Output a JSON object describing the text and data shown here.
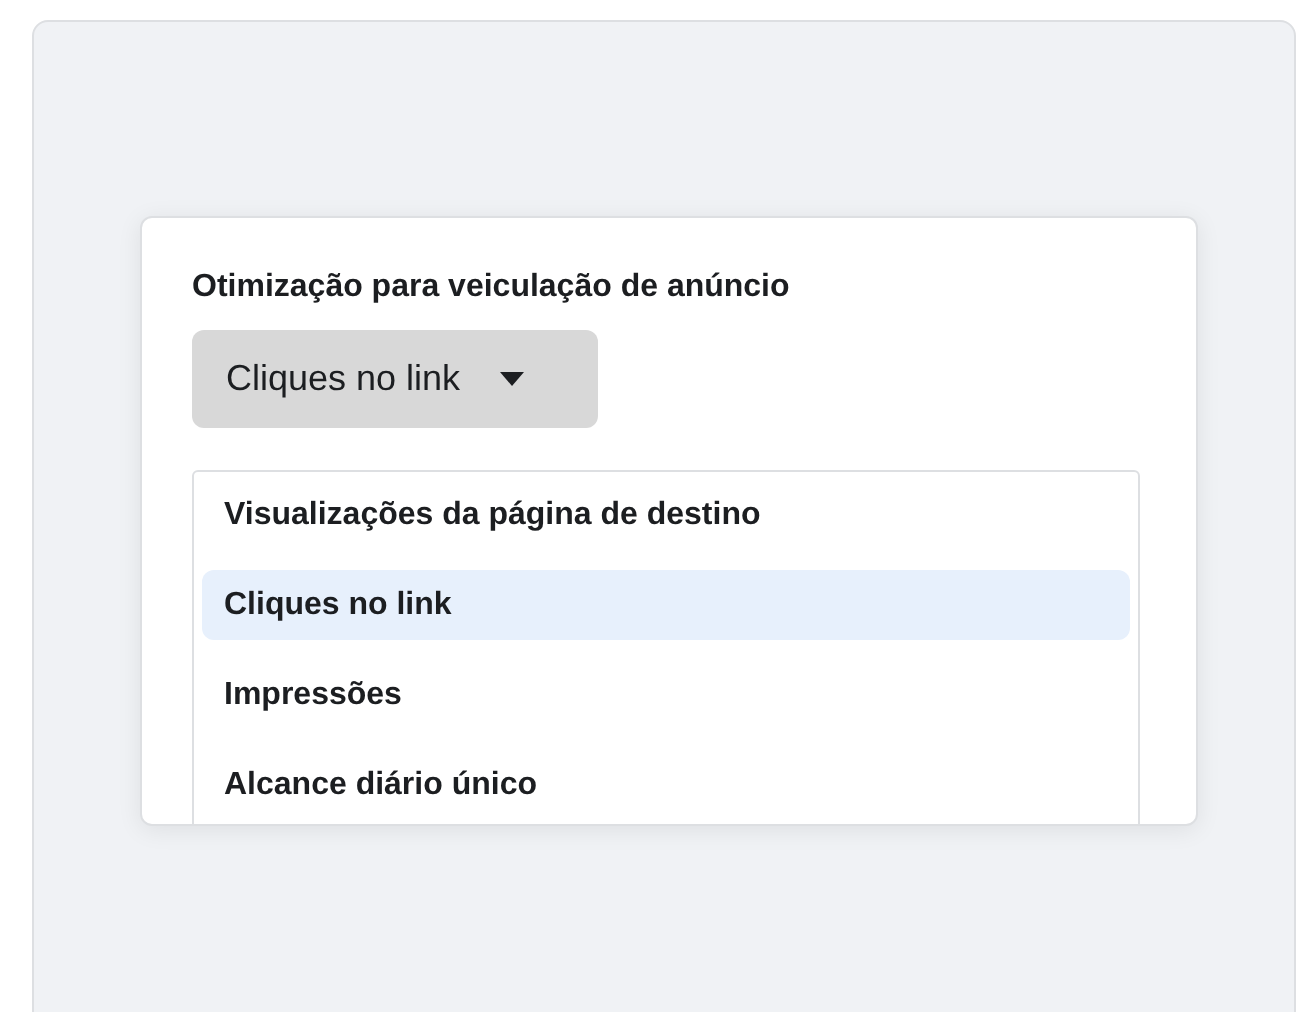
{
  "field": {
    "label": "Otimização para veiculação de anúncio",
    "value": "Cliques no link"
  },
  "options": [
    {
      "label": "Visualizações da página de destino",
      "selected": false
    },
    {
      "label": "Cliques no link",
      "selected": true
    },
    {
      "label": "Impressões",
      "selected": false
    },
    {
      "label": "Alcance diário único",
      "selected": false
    }
  ]
}
